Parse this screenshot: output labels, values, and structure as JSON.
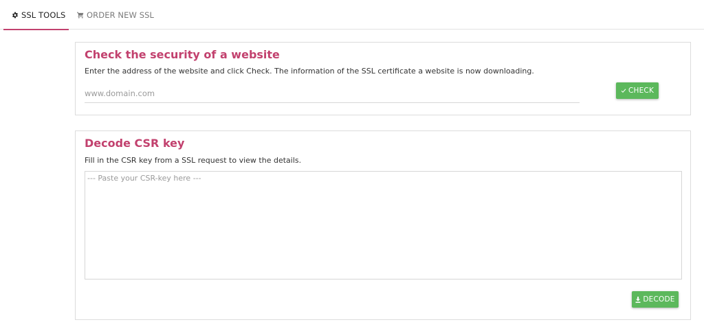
{
  "tabs": [
    {
      "label": "SSL TOOLS",
      "icon": "gear-icon",
      "active": true
    },
    {
      "label": "ORDER NEW SSL",
      "icon": "cart-icon",
      "active": false
    }
  ],
  "check": {
    "title": "Check the security of a website",
    "description": "Enter the address of the website and click Check. The information of the SSL certificate a website is now downloading.",
    "input_placeholder": "www.domain.com",
    "input_value": "",
    "button_label": "CHECK",
    "button_icon": "checkmark-icon"
  },
  "csr": {
    "title": "Decode CSR key",
    "description": "Fill in the CSR key from a SSL request to view the details.",
    "textarea_placeholder": "--- Paste your CSR-key here ---",
    "button_label": "DECODE",
    "button_icon": "download-icon"
  },
  "colors": {
    "accent": "#c2416e",
    "button_green": "#5cb85c"
  }
}
